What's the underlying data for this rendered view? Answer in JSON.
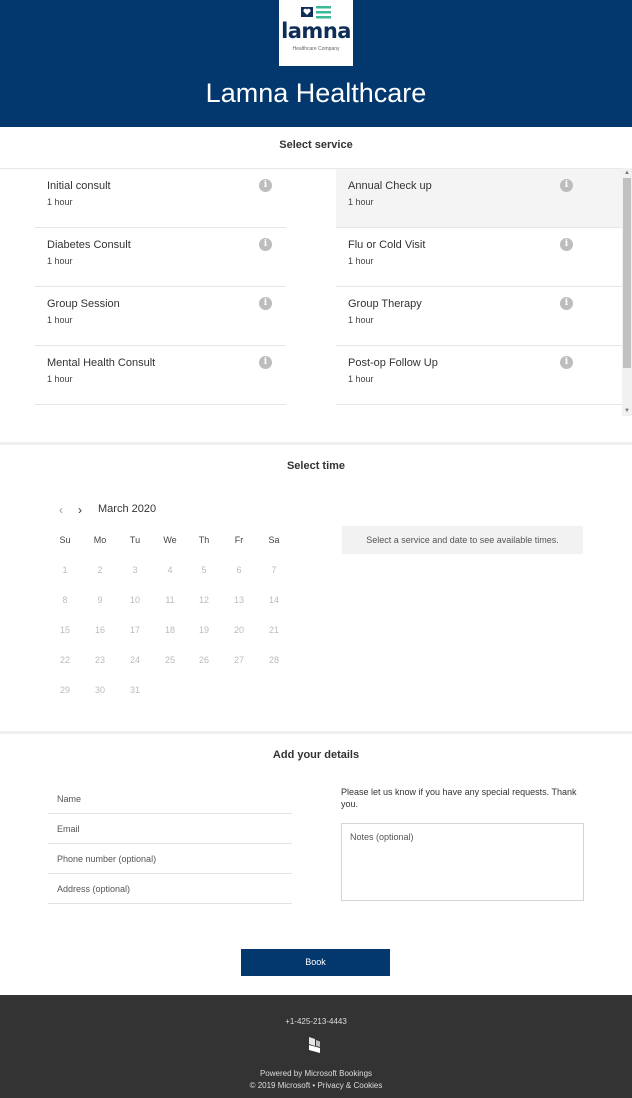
{
  "header": {
    "logo_word": "lamna",
    "logo_sub": "Healthcare Company",
    "title": "Lamna Healthcare"
  },
  "services": {
    "section_title": "Select service",
    "items": [
      {
        "name": "Initial consult",
        "duration": "1 hour"
      },
      {
        "name": "Annual Check up",
        "duration": "1 hour"
      },
      {
        "name": "Diabetes Consult",
        "duration": "1 hour"
      },
      {
        "name": "Flu or Cold Visit",
        "duration": "1 hour"
      },
      {
        "name": "Group Session",
        "duration": "1 hour"
      },
      {
        "name": "Group Therapy",
        "duration": "1 hour"
      },
      {
        "name": "Mental Health Consult",
        "duration": "1 hour"
      },
      {
        "name": "Post-op Follow Up",
        "duration": "1 hour"
      }
    ],
    "selected": "Annual Check up",
    "info_glyph": "i"
  },
  "time": {
    "section_title": "Select time",
    "month": "March 2020",
    "prev_glyph": "‹",
    "next_glyph": "›",
    "weekdays": [
      "Su",
      "Mo",
      "Tu",
      "We",
      "Th",
      "Fr",
      "Sa"
    ],
    "days": [
      "1",
      "2",
      "3",
      "4",
      "5",
      "6",
      "7",
      "8",
      "9",
      "10",
      "11",
      "12",
      "13",
      "14",
      "15",
      "16",
      "17",
      "18",
      "19",
      "20",
      "21",
      "22",
      "23",
      "24",
      "25",
      "26",
      "27",
      "28",
      "29",
      "30",
      "31"
    ],
    "message": "Select a service and date to see available times."
  },
  "details": {
    "section_title": "Add your details",
    "name_placeholder": "Name",
    "email_placeholder": "Email",
    "phone_placeholder": "Phone number (optional)",
    "address_placeholder": "Address (optional)",
    "request_note": "Please let us know if you have any special requests. Thank you.",
    "notes_placeholder": "Notes (optional)"
  },
  "book_label": "Book",
  "footer": {
    "phone": "+1-425-213-4443",
    "powered": "Powered by Microsoft Bookings",
    "copyright": "© 2019 Microsoft",
    "separator": "•",
    "privacy": "Privacy & Cookies"
  },
  "colors": {
    "brand": "#03386f",
    "footer": "#333333",
    "logo_teal": "#3fb89a"
  }
}
